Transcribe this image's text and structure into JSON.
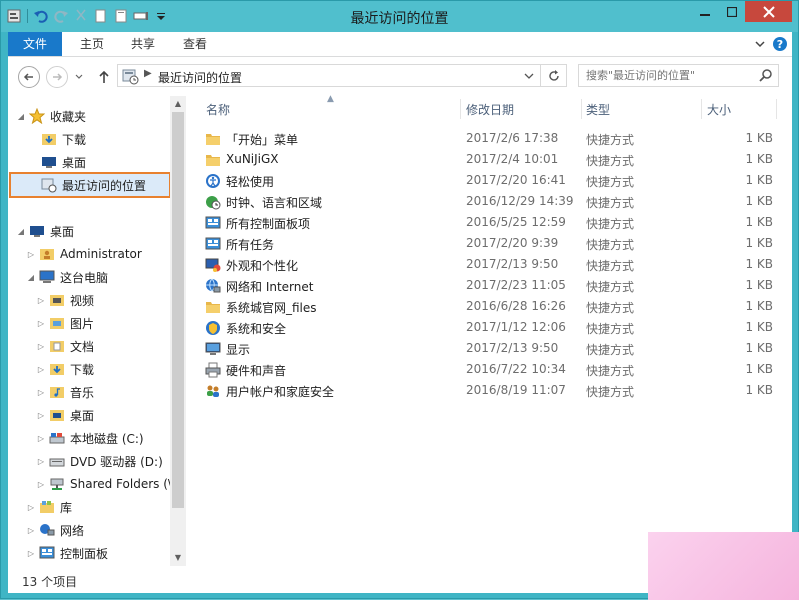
{
  "window": {
    "title": "最近访问的位置"
  },
  "ribbon": {
    "tabs": [
      "文件",
      "主页",
      "共享",
      "查看"
    ]
  },
  "address": {
    "path": "最近访问的位置"
  },
  "search": {
    "placeholder": "搜索\"最近访问的位置\""
  },
  "nav": {
    "favorites": "收藏夹",
    "fav_items": [
      "下载",
      "桌面",
      "最近访问的位置"
    ],
    "desktop": "桌面",
    "admin": "Administrator",
    "thispc": "这台电脑",
    "pc_items": [
      "视频",
      "图片",
      "文档",
      "下载",
      "音乐",
      "桌面",
      "本地磁盘 (C:)",
      "DVD 驱动器 (D:)",
      "Shared Folders (\\"
    ],
    "library": "库",
    "network": "网络",
    "control": "控制面板"
  },
  "columns": {
    "name": "名称",
    "date": "修改日期",
    "type": "类型",
    "size": "大小"
  },
  "files": [
    {
      "name": "「开始」菜单",
      "date": "2017/2/6 17:38",
      "type": "快捷方式",
      "size": "1 KB",
      "icon": "folder-icon"
    },
    {
      "name": "XuNiJiGX",
      "date": "2017/2/4 10:01",
      "type": "快捷方式",
      "size": "1 KB",
      "icon": "folder-icon"
    },
    {
      "name": "轻松使用",
      "date": "2017/2/20 16:41",
      "type": "快捷方式",
      "size": "1 KB",
      "icon": "ease-of-access-icon"
    },
    {
      "name": "时钟、语言和区域",
      "date": "2016/12/29 14:39",
      "type": "快捷方式",
      "size": "1 KB",
      "icon": "clock-globe-icon"
    },
    {
      "name": "所有控制面板项",
      "date": "2016/5/25 12:59",
      "type": "快捷方式",
      "size": "1 KB",
      "icon": "control-panel-icon"
    },
    {
      "name": "所有任务",
      "date": "2017/2/20 9:39",
      "type": "快捷方式",
      "size": "1 KB",
      "icon": "control-panel-icon"
    },
    {
      "name": "外观和个性化",
      "date": "2017/2/13 9:50",
      "type": "快捷方式",
      "size": "1 KB",
      "icon": "appearance-icon"
    },
    {
      "name": "网络和 Internet",
      "date": "2017/2/23 11:05",
      "type": "快捷方式",
      "size": "1 KB",
      "icon": "network-globe-icon"
    },
    {
      "name": "系统城官网_files",
      "date": "2016/6/28 16:26",
      "type": "快捷方式",
      "size": "1 KB",
      "icon": "folder-icon"
    },
    {
      "name": "系统和安全",
      "date": "2017/1/12 12:06",
      "type": "快捷方式",
      "size": "1 KB",
      "icon": "security-icon"
    },
    {
      "name": "显示",
      "date": "2017/2/13 9:50",
      "type": "快捷方式",
      "size": "1 KB",
      "icon": "monitor-icon"
    },
    {
      "name": "硬件和声音",
      "date": "2016/7/22 10:34",
      "type": "快捷方式",
      "size": "1 KB",
      "icon": "printer-icon"
    },
    {
      "name": "用户帐户和家庭安全",
      "date": "2016/8/19 11:07",
      "type": "快捷方式",
      "size": "1 KB",
      "icon": "users-icon"
    }
  ],
  "status": {
    "count": "13 个项目"
  },
  "colors": {
    "titlebar": "#50bfcd",
    "file_tab": "#1979ca",
    "close": "#c7483d",
    "selection_outline": "#e8812f"
  }
}
